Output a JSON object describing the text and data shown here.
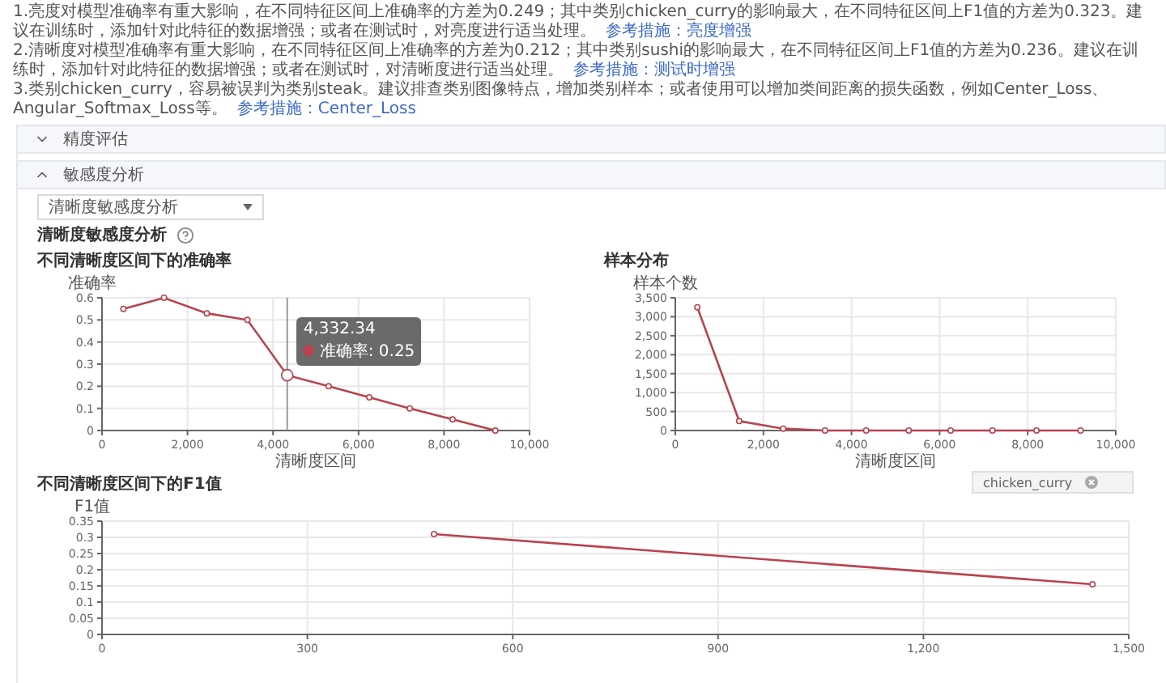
{
  "notes": [
    {
      "text": "1.亮度对模型准确率有重大影响，在不同特征区间上准确率的方差为0.249；其中类别chicken_curry的影响最大，在不同特征区间上F1值的方差为0.323。建议在训练时，添加针对此特征的数据增强；或者在测试时，对亮度进行适当处理。",
      "link": "参考措施：亮度增强"
    },
    {
      "text": "2.清晰度对模型准确率有重大影响，在不同特征区间上准确率的方差为0.212；其中类别sushi的影响最大，在不同特征区间上F1值的方差为0.236。建议在训练时，添加针对此特征的数据增强；或者在测试时，对清晰度进行适当处理。",
      "link": "参考措施：测试时增强"
    },
    {
      "text": "3.类别chicken_curry，容易被误判为类别steak。建议排查类别图像特点，增加类别样本；或者使用可以增加类间距离的损失函数，例如Center_Loss、Angular_Softmax_Loss等。",
      "link": "参考措施：Center_Loss"
    }
  ],
  "sections": [
    {
      "title": "精度评估",
      "expanded": false
    },
    {
      "title": "敏感度分析",
      "expanded": true
    }
  ],
  "analysis": {
    "dropdown": "清晰度敏感度分析",
    "label": "清晰度敏感度分析",
    "accuracy": {
      "tooltip": {
        "title": "4,332.34",
        "label": "准确率: 0.25"
      },
      "chart_data": {
        "type": "line",
        "title": "不同清晰度区间下的准确率",
        "xlabel": "清晰度区间",
        "ylabel": "准确率",
        "xlim": [
          0,
          10000
        ],
        "ylim": [
          0,
          0.6
        ],
        "xticks": [
          0,
          {
            "value": 2000,
            "label": "2,000"
          },
          {
            "value": 4000,
            "label": "4,000"
          },
          {
            "value": 6000,
            "label": "6,000"
          },
          {
            "value": 8000,
            "label": "8,000"
          },
          {
            "value": 10000,
            "label": "10,000"
          }
        ],
        "yticks": [
          0,
          0.1,
          0.2,
          0.3,
          0.4,
          0.5,
          0.6
        ],
        "x": [
          500,
          1450,
          2450,
          3400,
          4332,
          5300,
          6250,
          7200,
          8200,
          9200
        ],
        "grid": true,
        "ref_lines": [
          {
            "axis": "x",
            "value": 4332.34
          }
        ],
        "series": [
          {
            "color": "#b8434e",
            "marker": true,
            "values": [
              0.55,
              0.6,
              0.53,
              0.5,
              0.25,
              0.2,
              0.15,
              0.1,
              0.05,
              0
            ]
          }
        ]
      }
    },
    "samples": {
      "chart_data": {
        "type": "line",
        "title": "样本分布",
        "xlabel": "清晰度区间",
        "ylabel": "样本个数",
        "xlim": [
          0,
          10000
        ],
        "ylim": [
          0,
          3500
        ],
        "xticks": [
          0,
          {
            "value": 2000,
            "label": "2,000"
          },
          {
            "value": 4000,
            "label": "4,000"
          },
          {
            "value": 6000,
            "label": "6,000"
          },
          {
            "value": 8000,
            "label": "8,000"
          },
          {
            "value": 10000,
            "label": "10,000"
          }
        ],
        "yticks": [
          0,
          500,
          {
            "value": 1000,
            "label": "1,000"
          },
          {
            "value": 1500,
            "label": "1,500"
          },
          {
            "value": 2000,
            "label": "2,000"
          },
          {
            "value": 2500,
            "label": "2,500"
          },
          {
            "value": 3000,
            "label": "3,000"
          },
          {
            "value": 3500,
            "label": "3,500"
          }
        ],
        "x": [
          500,
          1450,
          2450,
          3400,
          4332,
          5300,
          6250,
          7200,
          8200,
          9200
        ],
        "grid": true,
        "series": [
          {
            "color": "#b8434e",
            "marker": true,
            "values": [
              3250,
              250,
              50,
              0,
              0,
              0,
              0,
              0,
              0,
              0
            ]
          }
        ]
      }
    },
    "f1": {
      "tag": "chicken_curry",
      "chart_data": {
        "type": "line",
        "title": "不同清晰度区间下的F1值",
        "ylabel": "F1值",
        "xlim": [
          0,
          1500
        ],
        "ylim": [
          0,
          0.35
        ],
        "xticks": [
          0,
          300,
          600,
          900,
          {
            "value": 1200,
            "label": "1,200"
          },
          {
            "value": 1500,
            "label": "1,500"
          }
        ],
        "yticks": [
          0,
          0.05,
          0.1,
          0.15,
          0.2,
          0.25,
          0.3,
          0.35
        ],
        "x": [
          485,
          1447
        ],
        "grid": true,
        "series": [
          {
            "color": "#b8434e",
            "marker": true,
            "values": [
              0.31,
              0.155
            ]
          }
        ]
      }
    }
  }
}
